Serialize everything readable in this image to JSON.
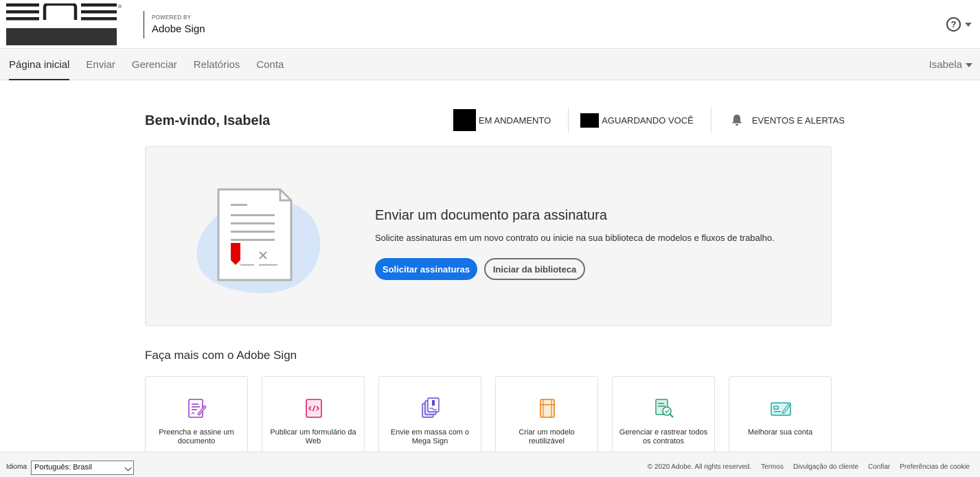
{
  "header": {
    "logo_text": "ENS",
    "powered_by": "POWERED BY",
    "product_name": "Adobe Sign",
    "help_icon": "help-circle-icon"
  },
  "nav": {
    "tabs": [
      {
        "label": "Página inicial",
        "active": true
      },
      {
        "label": "Enviar",
        "active": false
      },
      {
        "label": "Gerenciar",
        "active": false
      },
      {
        "label": "Relatórios",
        "active": false
      },
      {
        "label": "Conta",
        "active": false
      }
    ],
    "user_name": "Isabela"
  },
  "welcome": {
    "title": "Bem-vindo, Isabela"
  },
  "status": {
    "in_progress_label": "EM ANDAMENTO",
    "waiting_label": "AGUARDANDO VOCÊ",
    "events_label": "EVENTOS E ALERTAS"
  },
  "hero": {
    "title": "Enviar um documento para assinatura",
    "description": "Solicite assinaturas em um novo contrato ou inicie na sua biblioteca de modelos e fluxos de trabalho.",
    "primary_button": "Solicitar assinaturas",
    "secondary_button": "Iniciar da biblioteca"
  },
  "more": {
    "title": "Faça mais com o Adobe Sign",
    "cards": [
      {
        "label": "Preencha e assine um documento",
        "icon": "fill-sign-icon",
        "color": "#9e3ec9"
      },
      {
        "label": "Publicar um formulário da Web",
        "icon": "web-form-icon",
        "color": "#d7246d"
      },
      {
        "label": "Envie em massa com o Mega Sign",
        "icon": "mega-sign-icon",
        "color": "#5c4bd1"
      },
      {
        "label": "Criar um modelo reutilizável",
        "icon": "template-icon",
        "color": "#e68619"
      },
      {
        "label": "Gerenciar e rastrear todos os contratos",
        "icon": "track-contracts-icon",
        "color": "#2d9d78"
      },
      {
        "label": "Melhorar sua conta",
        "icon": "upgrade-account-icon",
        "color": "#1fa7a4"
      }
    ]
  },
  "footer": {
    "language_label": "Idioma",
    "language_value": "Português: Brasil",
    "copyright": "© 2020 Adobe. All rights reserved.",
    "links": [
      "Termos",
      "Divulgação do cliente",
      "Confiar",
      "Preferências de cookie"
    ]
  },
  "colors": {
    "accent": "#1473e6",
    "signature_red": "#e30000"
  }
}
